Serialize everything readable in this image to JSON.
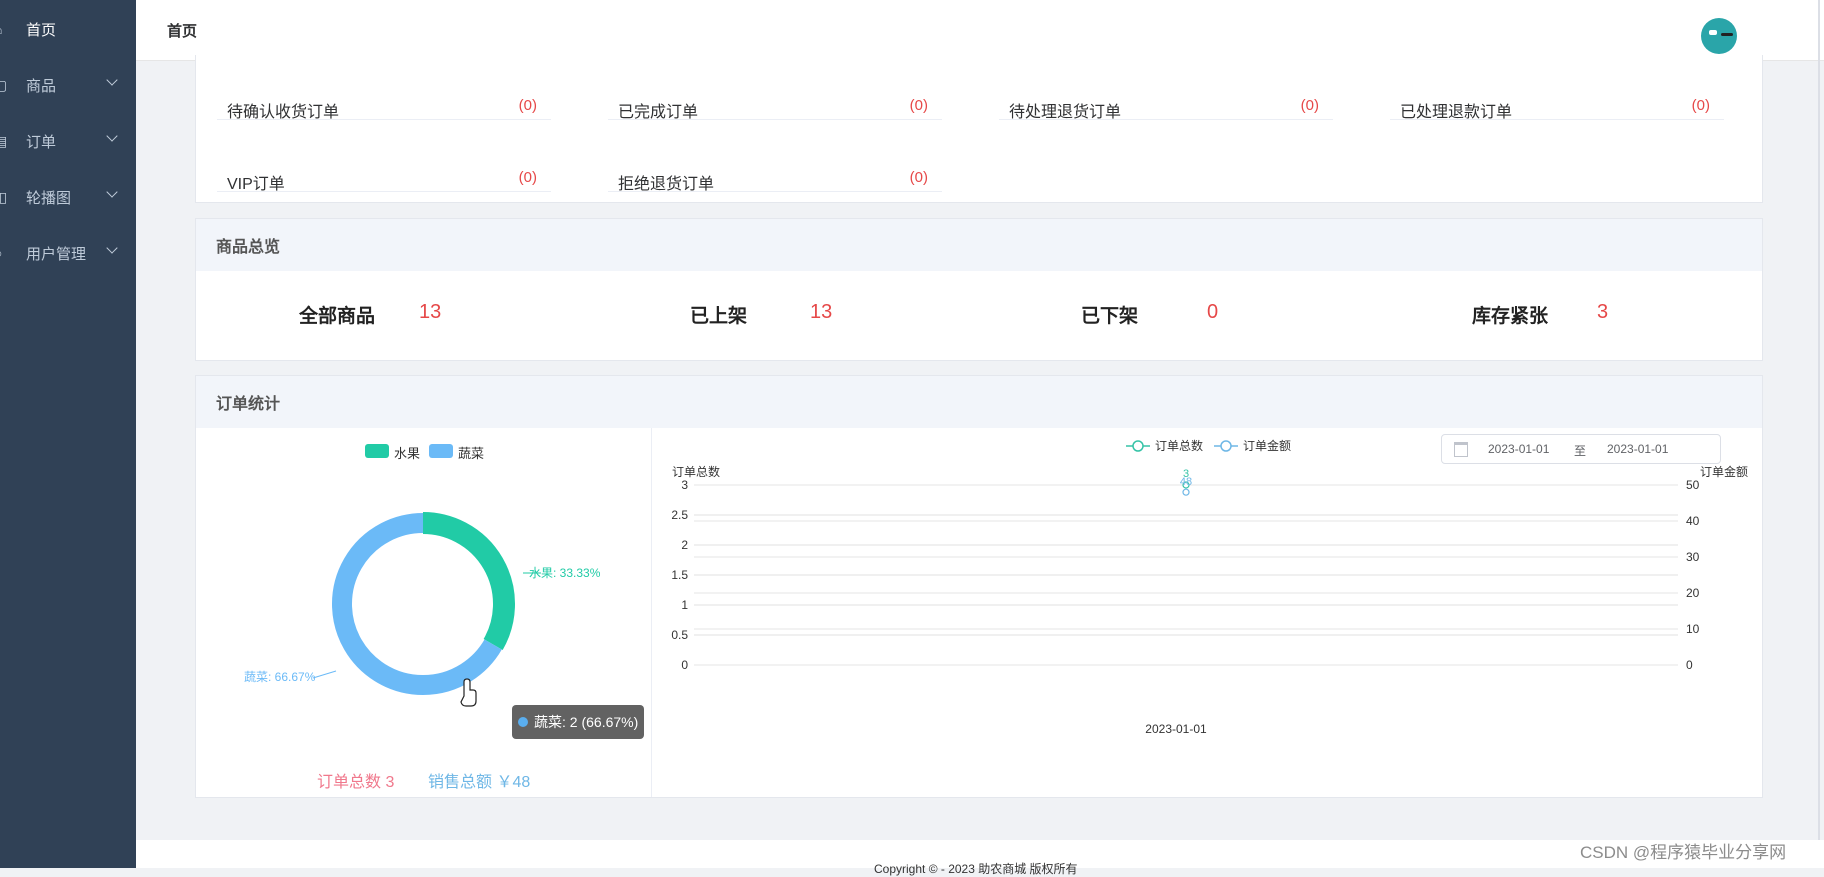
{
  "sidebar": {
    "items": [
      {
        "label": "首页",
        "icon": "home-icon"
      },
      {
        "label": "商品",
        "icon": "goods-icon"
      },
      {
        "label": "订单",
        "icon": "order-icon"
      },
      {
        "label": "轮播图",
        "icon": "carousel-icon"
      },
      {
        "label": "用户管理",
        "icon": "user-icon"
      }
    ]
  },
  "header": {
    "breadcrumb": "首页"
  },
  "orders": [
    {
      "label": "待确认收货订单",
      "count": "(0)"
    },
    {
      "label": "已完成订单",
      "count": "(0)"
    },
    {
      "label": "待处理退货订单",
      "count": "(0)"
    },
    {
      "label": "已处理退款订单",
      "count": "(0)"
    },
    {
      "label": "VIP订单",
      "count": "(0)"
    },
    {
      "label": "拒绝退货订单",
      "count": "(0)"
    }
  ],
  "goods": {
    "title": "商品总览",
    "items": [
      {
        "label": "全部商品",
        "value": "13"
      },
      {
        "label": "已上架",
        "value": "13"
      },
      {
        "label": "已下架",
        "value": "0"
      },
      {
        "label": "库存紧张",
        "value": "3"
      }
    ]
  },
  "stats": {
    "title": "订单统计",
    "order_total_text": "订单总数 3",
    "sales_total_text": "销售总额 ￥48",
    "tooltip": "蔬菜: 2 (66.67%)",
    "date_sep": "至",
    "date_start": "2023-01-01",
    "date_end": "2023-01-01"
  },
  "chart_data": [
    {
      "type": "pie",
      "legend": [
        "水果",
        "蔬菜"
      ],
      "slices": [
        {
          "name": "水果",
          "value": 1,
          "percent": 33.33,
          "label": "水果: 33.33%",
          "color": "#21cba6"
        },
        {
          "name": "蔬菜",
          "value": 2,
          "percent": 66.67,
          "label": "蔬菜: 66.67%",
          "color": "#6bbaf7"
        }
      ]
    },
    {
      "type": "line",
      "legend": [
        "订单总数",
        "订单金额"
      ],
      "x": [
        "2023-01-01"
      ],
      "series": [
        {
          "name": "订单总数",
          "values": [
            3
          ],
          "color": "#36c3a7",
          "axis": "left"
        },
        {
          "name": "订单金额",
          "values": [
            48
          ],
          "color": "#6fb7e6",
          "axis": "right"
        }
      ],
      "ylabel_left": "订单总数",
      "ylabel_right": "订单金额",
      "ylim_left": [
        0,
        3
      ],
      "ylim_right": [
        0,
        50
      ],
      "yticks_left": [
        "0",
        "0.5",
        "1",
        "1.5",
        "2",
        "2.5",
        "3"
      ],
      "yticks_right": [
        "0",
        "10",
        "20",
        "30",
        "40",
        "50"
      ],
      "data_labels": [
        "3",
        "48"
      ]
    }
  ],
  "footer": {
    "text": "Copyright © - 2023 助农商城 版权所有"
  },
  "watermark": "CSDN @程序猿毕业分享网"
}
